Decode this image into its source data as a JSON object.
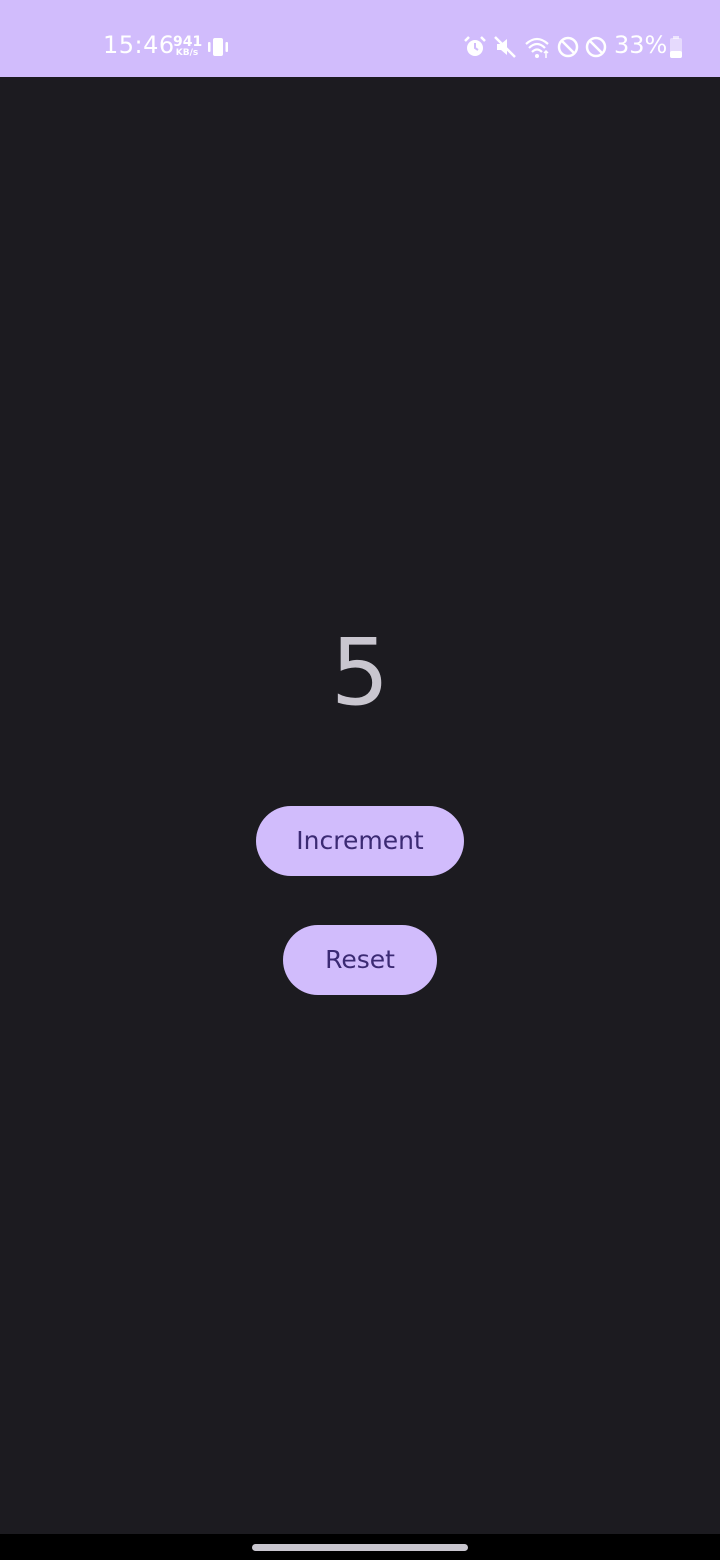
{
  "status_bar": {
    "time": "15:46",
    "net_speed_value": "941",
    "net_speed_unit": "KB/s",
    "battery_percent": "33%",
    "icons": [
      "vibrate-icon",
      "alarm-icon",
      "mute-icon",
      "wifi-icon",
      "block-icon",
      "block-icon",
      "battery-icon"
    ]
  },
  "counter": {
    "value": "5"
  },
  "buttons": {
    "increment_label": "Increment",
    "reset_label": "Reset"
  },
  "colors": {
    "accent": "#d1bcfc",
    "background": "#1c1b20",
    "button_text": "#3b2a73",
    "counter_text": "#c9c6cf"
  }
}
